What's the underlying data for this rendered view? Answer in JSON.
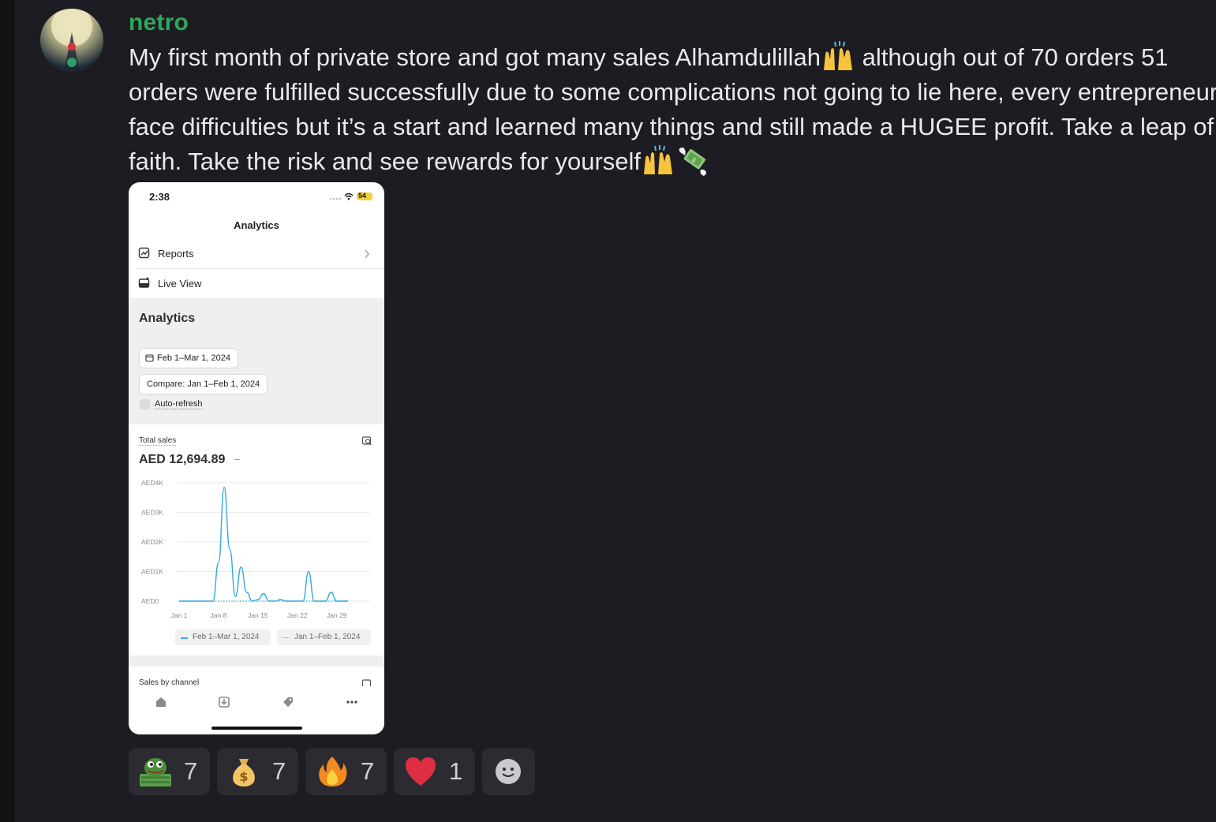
{
  "message": {
    "username": "netro",
    "lines": [
      "My first month of private store and got many sales Alhamdulillah",
      " although out of 70 orders 51",
      "orders were fulfilled successfully due to some complications not going to lie here, every entrepreneur",
      "face difficulties but it’s a start and learned many things and still made a HUGEE profit. Take a leap of",
      "faith. Take the risk and see rewards for yourself"
    ],
    "emoji_inline": [
      "raising-hands",
      "raising-hands",
      "money-with-wings"
    ]
  },
  "phone": {
    "status_time": "2:38",
    "battery": "54",
    "nav_title": "Analytics",
    "menu": [
      {
        "label": "Reports",
        "icon": "report-icon"
      },
      {
        "label": "Live View",
        "icon": "live-view-icon"
      }
    ],
    "section_title": "Analytics",
    "date_range": "Feb 1–Mar 1, 2024",
    "compare": "Compare: Jan 1–Feb 1, 2024",
    "auto_refresh": "Auto-refresh",
    "total_sales_label": "Total sales",
    "total_sales_value": "AED 12,694.89",
    "total_sales_change": "–",
    "legend": [
      "Feb 1–Mar 1, 2024",
      "Jan 1–Feb 1, 2024"
    ],
    "next_card_title": "Sales by channel",
    "accent_color": "#36a9e1"
  },
  "chart_data": {
    "type": "line",
    "y_ticks": [
      "AED4K",
      "AED3K",
      "AED2K",
      "AED1K",
      "AED0"
    ],
    "x_ticks": [
      "Jan 1",
      "Jan 8",
      "Jan 15",
      "Jan 22",
      "Jan 29"
    ],
    "ylim": [
      0,
      4000
    ],
    "series": [
      {
        "name": "Feb 1–Mar 1, 2024",
        "style": "solid",
        "values": [
          0,
          0,
          0,
          0,
          0,
          0,
          0,
          1300,
          3850,
          1750,
          150,
          1150,
          300,
          0,
          50,
          250,
          0,
          0,
          50,
          0,
          0,
          0,
          0,
          1000,
          0,
          0,
          0,
          300,
          0,
          0,
          0
        ]
      },
      {
        "name": "Jan 1–Feb 1, 2024",
        "style": "dotted",
        "values": [
          0,
          0,
          0,
          0,
          0,
          0,
          0,
          0,
          0,
          0,
          0,
          0,
          0,
          0,
          0,
          0,
          0,
          0,
          0,
          0,
          0,
          0,
          0,
          0,
          0,
          0,
          0,
          0,
          0,
          0,
          0
        ]
      }
    ]
  },
  "reactions": [
    {
      "emoji": "pepe-money-icon",
      "count": "7"
    },
    {
      "emoji": "money-bag-icon",
      "count": "7"
    },
    {
      "emoji": "fire-icon",
      "count": "7"
    },
    {
      "emoji": "red-heart-icon",
      "count": "1"
    },
    {
      "emoji": "add-reaction-icon",
      "count": ""
    }
  ]
}
